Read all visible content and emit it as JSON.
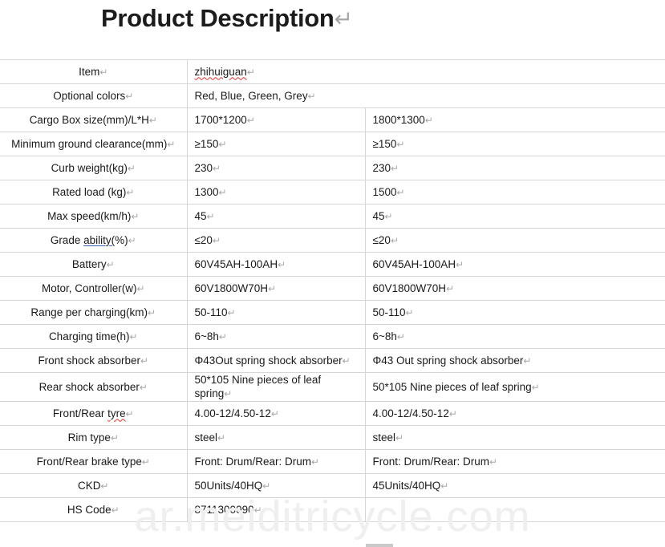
{
  "title": {
    "text": "Product Description",
    "paragraph_mark": "↵"
  },
  "marks": {
    "paragraph": "↵"
  },
  "watermark": {
    "text": "ar.meiditricycle.com",
    "color": "#efefef"
  },
  "table": {
    "columns": 3,
    "rows": [
      {
        "label": "Item",
        "label_spellcheck": false,
        "merged": true,
        "value": "zhihuiguan",
        "value_spellcheck": true
      },
      {
        "label": "Optional colors",
        "merged": true,
        "value": "Red, Blue, Green, Grey"
      },
      {
        "label": "Cargo Box size(mm)/L*H",
        "merged": false,
        "value_a": "1700*1200",
        "value_b": "1800*1300"
      },
      {
        "label": "Minimum ground clearance(mm)",
        "merged": false,
        "value_a": "≥150",
        "value_b": "≥150"
      },
      {
        "label": "Curb weight(kg)",
        "merged": false,
        "value_a": "230",
        "value_b": "230"
      },
      {
        "label": "Rated load (kg)",
        "merged": false,
        "value_a": "1300",
        "value_b": "1500"
      },
      {
        "label": "Max speed(km/h)",
        "merged": false,
        "value_a": "45",
        "value_b": "45"
      },
      {
        "label": "Grade ability(%)",
        "label_parts": {
          "prefix": "Grade ",
          "linked": "ability(",
          "suffix": "%)"
        },
        "merged": false,
        "value_a": "≤20",
        "value_b": "≤20"
      },
      {
        "label": "Battery",
        "merged": false,
        "value_a": "60V45AH-100AH",
        "value_b": "60V45AH-100AH"
      },
      {
        "label": "Motor, Controller(w)",
        "merged": false,
        "value_a": "60V1800W70H",
        "value_b": "60V1800W70H"
      },
      {
        "label": "Range per charging(km)",
        "merged": false,
        "value_a": "50-110",
        "value_b": "50-110"
      },
      {
        "label": "Charging time(h)",
        "merged": false,
        "value_a": "6~8h",
        "value_b": "6~8h"
      },
      {
        "label": "Front shock absorber",
        "merged": false,
        "value_a": "Φ43Out spring shock absorber",
        "value_b": "Φ43 Out spring shock absorber"
      },
      {
        "label": "Rear shock absorber",
        "merged": false,
        "value_a": "50*105 Nine pieces of leaf spring",
        "value_b": "50*105 Nine pieces of leaf spring"
      },
      {
        "label": "Front/Rear tyre",
        "label_parts": {
          "prefix": "Front/Rear ",
          "misspelled": "tyre",
          "suffix": ""
        },
        "merged": false,
        "value_a": "4.00-12/4.50-12",
        "value_b": "4.00-12/4.50-12"
      },
      {
        "label": "Rim type",
        "merged": false,
        "value_a": "steel",
        "value_b": "steel"
      },
      {
        "label": "Front/Rear brake type",
        "merged": false,
        "value_a": "Front: Drum/Rear: Drum",
        "value_b": "Front: Drum/Rear: Drum"
      },
      {
        "label": "CKD",
        "merged": false,
        "value_a": "50Units/40HQ",
        "value_b": "45Units/40HQ"
      },
      {
        "label": "HS Code",
        "merged": false,
        "value_a": "8711300090",
        "value_b": ""
      }
    ]
  }
}
